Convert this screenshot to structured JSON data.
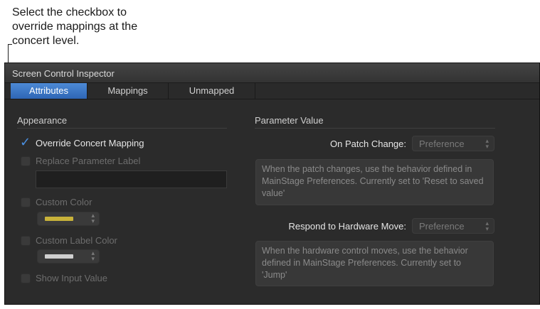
{
  "callout": {
    "text": "Select the checkbox to\noverride mappings at the\nconcert level."
  },
  "window": {
    "title": "Screen Control Inspector"
  },
  "tabs": [
    {
      "label": "Attributes",
      "active": true
    },
    {
      "label": "Mappings",
      "active": false
    },
    {
      "label": "Unmapped",
      "active": false
    }
  ],
  "appearance": {
    "title": "Appearance",
    "override_label": "Override Concert Mapping",
    "override_checked": true,
    "replace_label": "Replace Parameter Label",
    "replace_value": "",
    "custom_color_label": "Custom Color",
    "custom_color_swatch": "#c8b23a",
    "custom_label_color_label": "Custom Label Color",
    "custom_label_color_swatch": "#cfcfcf",
    "show_input_label": "Show Input Value"
  },
  "parameter_value": {
    "title": "Parameter Value",
    "on_patch_change_label": "On Patch Change:",
    "on_patch_change_value": "Preference",
    "on_patch_change_desc": "When the patch changes, use the behavior defined in MainStage Preferences. Currently set to 'Reset to saved value'",
    "hardware_move_label": "Respond to Hardware Move:",
    "hardware_move_value": "Preference",
    "hardware_move_desc": "When the hardware control moves, use the behavior defined in MainStage Preferences. Currently set to 'Jump'"
  },
  "colors": {
    "accent": "#4a90e2",
    "panel_bg": "#2b2b2b"
  },
  "icons": {
    "checkmark": "checkmark-icon",
    "stepper": "up-down-arrows-icon"
  }
}
